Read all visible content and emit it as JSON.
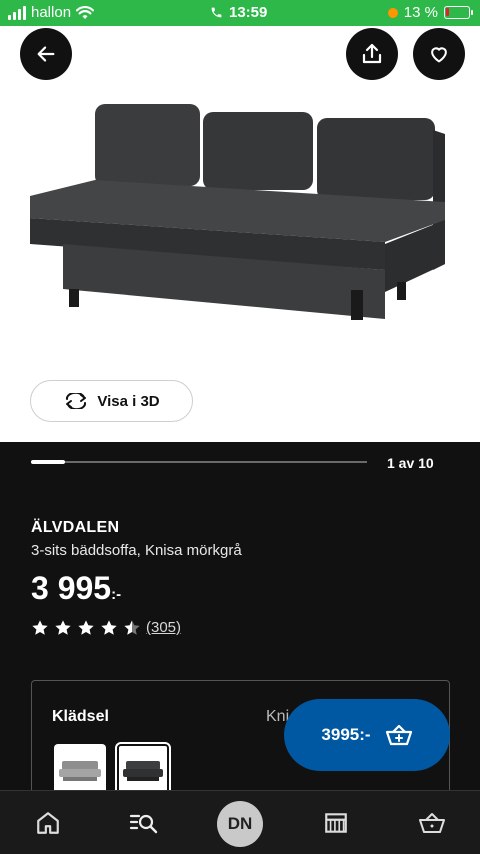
{
  "status_bar": {
    "carrier": "hallon",
    "time": "13:59",
    "battery": "13 %"
  },
  "hero": {
    "view3d_label": "Visa i 3D"
  },
  "gallery": {
    "counter": "1 av 10",
    "progress": 0.1
  },
  "product": {
    "name": "ÄLVDALEN",
    "description": "3-sits bäddsoffa, Knisa mörkgrå",
    "price": "3 995",
    "price_suffix": ":-",
    "rating": 4.5,
    "review_count": "(305)"
  },
  "options": {
    "title": "Klädsel",
    "value": "Kni"
  },
  "cart_button": {
    "label": "3995:-"
  },
  "bottom_nav": {
    "profile_initials": "DN"
  },
  "colors": {
    "status_green": "#2fb84a",
    "ikea_blue": "#0058a3",
    "dark_bg": "#111111"
  }
}
